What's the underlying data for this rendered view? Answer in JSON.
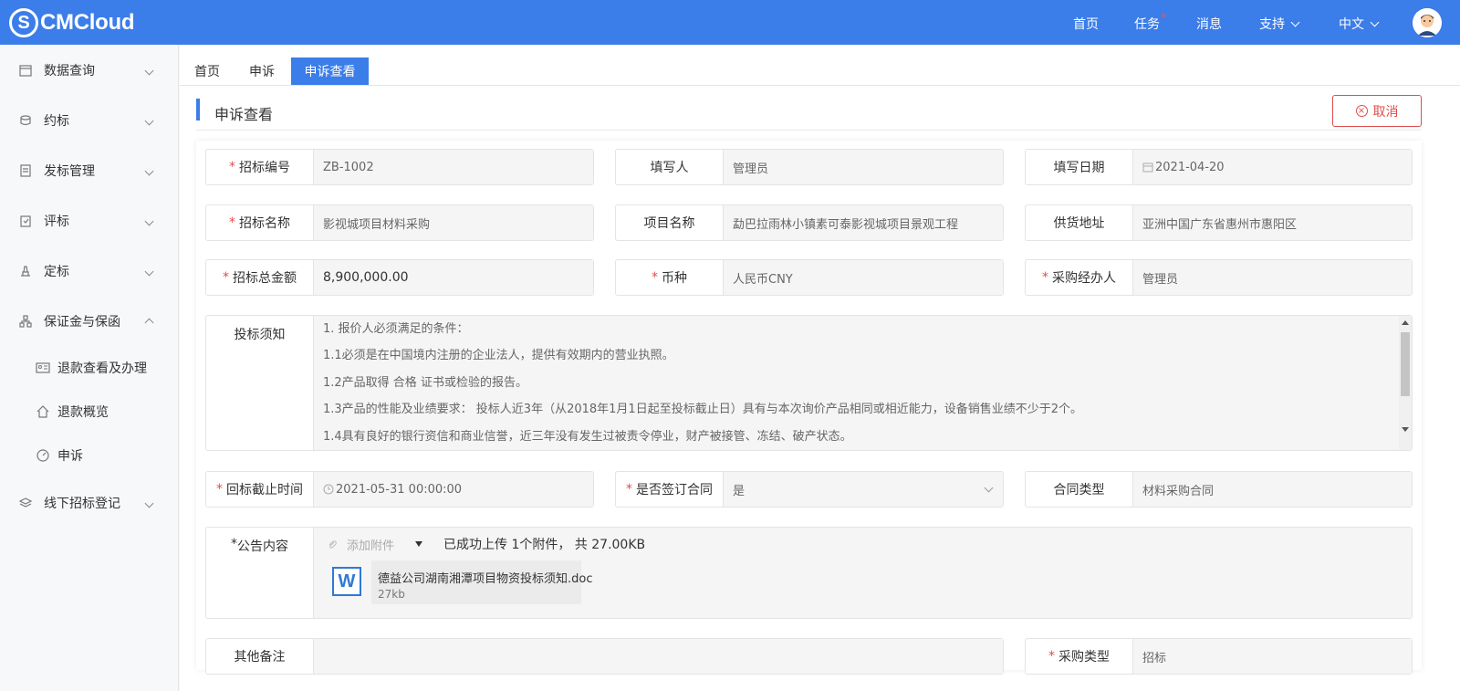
{
  "header": {
    "logo_text": "CMCloud",
    "logo_mark": "S",
    "nav": {
      "home": "首页",
      "tasks": "任务",
      "tasks_badge": "*",
      "messages": "消息",
      "support": "支持",
      "language": "中文"
    },
    "accent_color": "#3b7de9"
  },
  "sidebar": {
    "items": [
      {
        "label": "数据查询",
        "icon": "database-icon"
      },
      {
        "label": "约标",
        "icon": "coins-icon"
      },
      {
        "label": "发标管理",
        "icon": "document-icon"
      },
      {
        "label": "评标",
        "icon": "clipboard-icon"
      },
      {
        "label": "定标",
        "icon": "stamp-icon"
      },
      {
        "label": "保证金与保函",
        "icon": "org-icon"
      },
      {
        "label": "线下招标登记",
        "icon": "layers-icon"
      }
    ],
    "sub_items": [
      {
        "label": "退款查看及办理",
        "icon": "id-card-icon"
      },
      {
        "label": "退款概览",
        "icon": "home-icon"
      },
      {
        "label": "申诉",
        "icon": "dashboard-icon"
      }
    ]
  },
  "tabs": [
    {
      "label": "首页"
    },
    {
      "label": "申诉"
    },
    {
      "label": "申诉查看"
    }
  ],
  "page": {
    "title": "申诉查看",
    "cancel_label": "取消",
    "cancel_icon": "close-circle-icon"
  },
  "form": {
    "tender_no": {
      "label": "招标编号",
      "value": "ZB-1002"
    },
    "filler": {
      "label": "填写人",
      "value": "管理员"
    },
    "fill_date": {
      "label": "填写日期",
      "value": "2021-04-20"
    },
    "tender_name": {
      "label": "招标名称",
      "value": "影视城项目材料采购"
    },
    "project_name": {
      "label": "项目名称",
      "value": "勐巴拉雨林小镇素可泰影视城项目景观工程"
    },
    "supply_address": {
      "label": "供货地址",
      "value": "亚洲中国广东省惠州市惠阳区"
    },
    "total_amount": {
      "label": "招标总金额",
      "value": "8,900,000.00"
    },
    "currency": {
      "label": "币种",
      "value": "人民币CNY"
    },
    "purchaser": {
      "label": "采购经办人",
      "value": "管理员"
    },
    "notice": {
      "label": "投标须知",
      "lines": [
        "1. 报价人必须满足的条件：",
        "1.1必须是在中国境内注册的企业法人，提供有效期内的营业执照。",
        "1.2产品取得 合格  证书或检验的报告。",
        "1.3产品的性能及业绩要求： 投标人近3年（从2018年1月1日起至投标截止日）具有与本次询价产品相同或相近能力，设备销售业绩不少于2个。",
        "1.4具有良好的银行资信和商业信誉，近三年没有发生过被责令停业，财产被接管、冻结、破产状态。"
      ]
    },
    "deadline": {
      "label": "回标截止时间",
      "value": "2021-05-31 00:00:00"
    },
    "sign_contract": {
      "label": "是否签订合同",
      "value": "是"
    },
    "contract_type": {
      "label": "合同类型",
      "value": "材料采购合同"
    },
    "announcement": {
      "label": "公告内容",
      "attach_label": "添加附件",
      "upload_status": "已成功上传 1个附件， 共 27.00KB",
      "file_name": "德益公司湖南湘潭项目物资投标须知.doc",
      "file_size": "27kb",
      "file_icon": "W"
    },
    "remarks": {
      "label": "其他备注",
      "value": ""
    },
    "purchase_type": {
      "label": "采购类型",
      "value": "招标"
    }
  }
}
